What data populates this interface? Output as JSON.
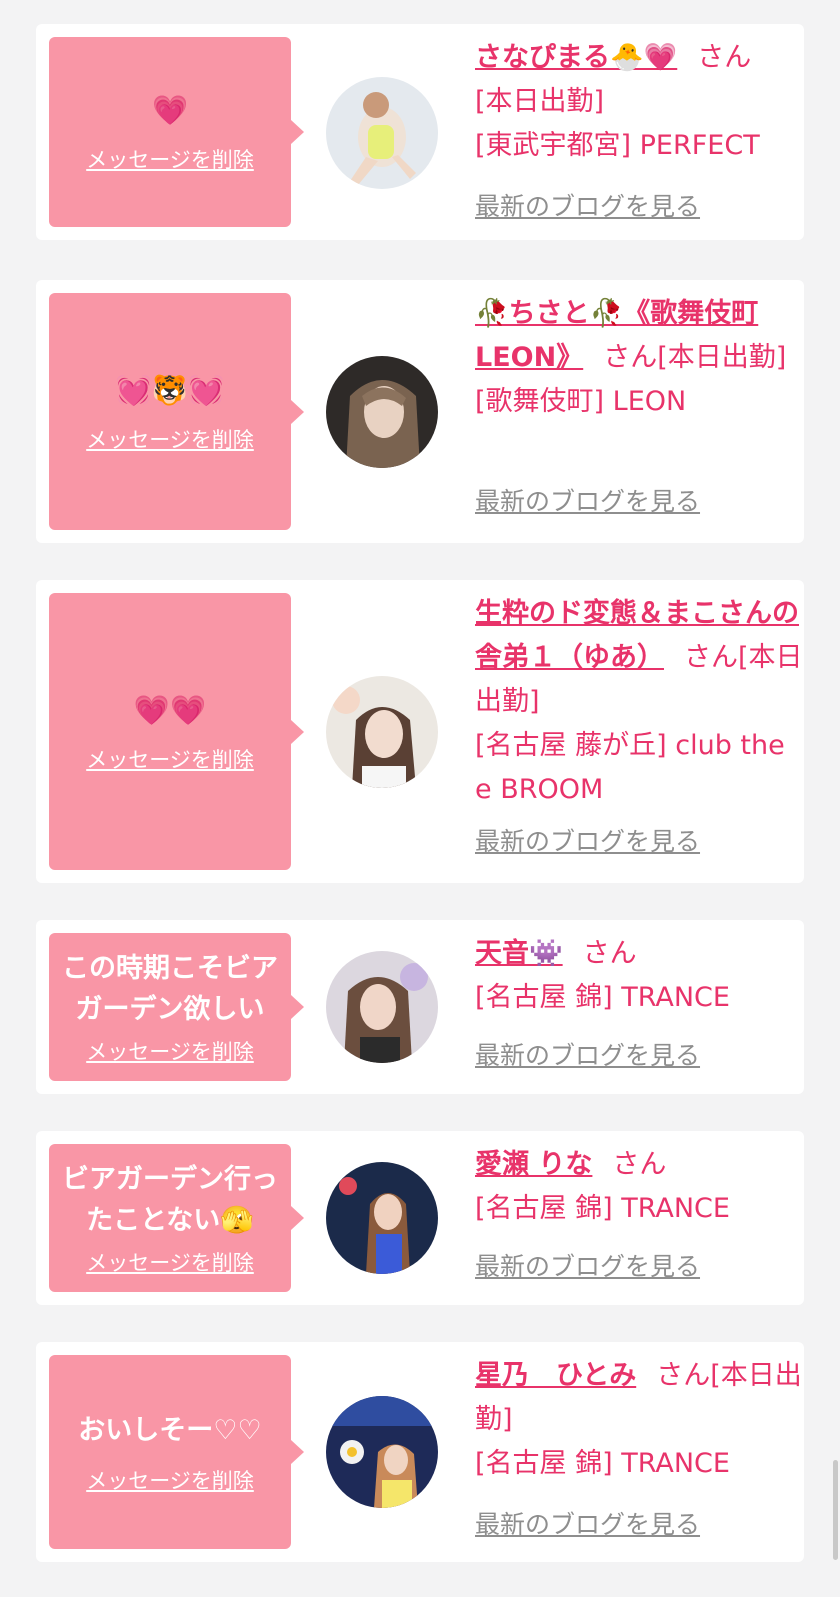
{
  "delete_label": "メッセージを削除",
  "blog_label": "最新のブログを見る",
  "san": "さん",
  "entries": [
    {
      "message": "💗",
      "name": "さなぴまる🐣💗",
      "status": "[本日出勤]",
      "shop": "[東武宇都宮] PERFECT"
    },
    {
      "message": "💓🐯💓",
      "name": "🥀ちさと🥀《歌舞伎町LEON》",
      "status": "[本日出勤]",
      "shop": "[歌舞伎町] LEON"
    },
    {
      "message": "💗💗",
      "name": "生粋のド変態＆まこさんの舎弟１（ゆあ）",
      "status": "[本日出勤]",
      "shop": "[名古屋 藤が丘] club the e BROOM"
    },
    {
      "message": "この時期こそビアガーデン欲しい",
      "name": "天音👾",
      "status": "",
      "shop": "[名古屋 錦] TRANCE"
    },
    {
      "message": "ビアガーデン行ったことない🫣",
      "name": "愛瀬 りな",
      "status": "",
      "shop": "[名古屋 錦] TRANCE"
    },
    {
      "message": "おいしそー♡♡",
      "name": "星乃　ひとみ",
      "status": "[本日出勤]",
      "shop": "[名古屋 錦] TRANCE"
    }
  ],
  "colors": {
    "accent": "#e8336a",
    "bubble": "#f996a6",
    "link_gray": "#8e8e8e",
    "background": "#f3f3f4"
  }
}
